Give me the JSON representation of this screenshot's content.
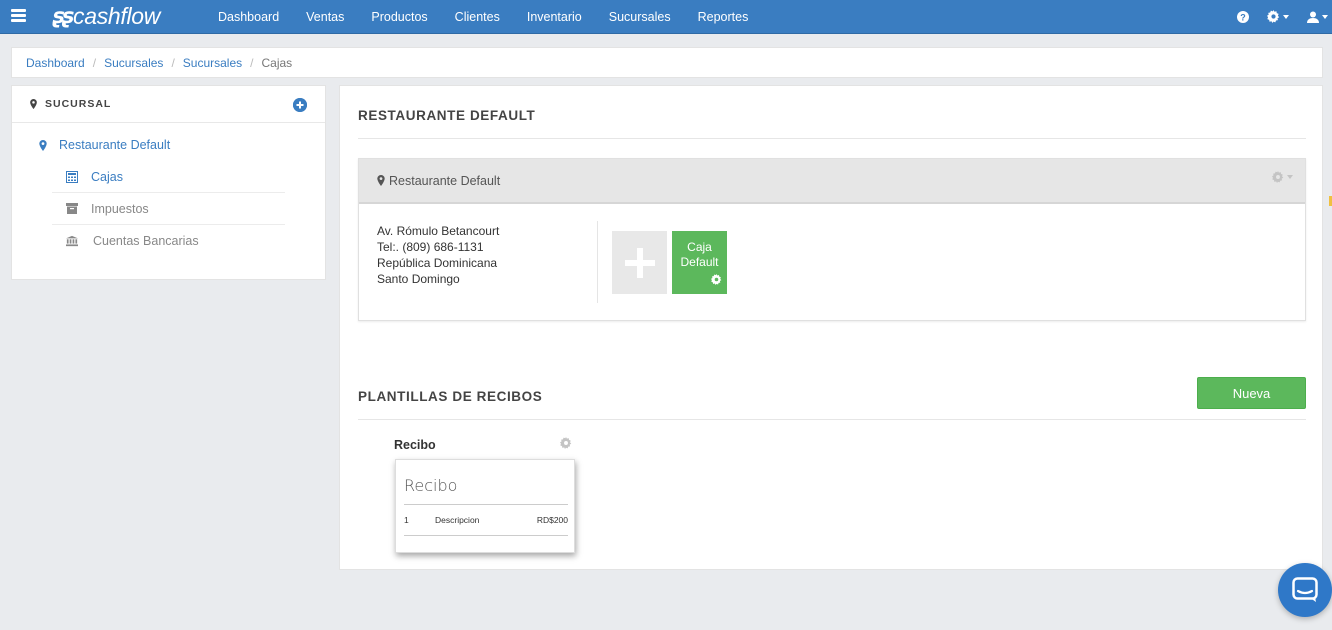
{
  "app": {
    "brand": "cashflow"
  },
  "nav": {
    "items": [
      "Dashboard",
      "Ventas",
      "Productos",
      "Clientes",
      "Inventario",
      "Sucursales",
      "Reportes"
    ]
  },
  "breadcrumb": {
    "items": [
      "Dashboard",
      "Sucursales",
      "Sucursales"
    ],
    "active": "Cajas"
  },
  "sidebar": {
    "header": "SUCURSAL",
    "branch": "Restaurante Default",
    "items": [
      {
        "label": "Cajas",
        "icon": "calculator-icon",
        "active": true
      },
      {
        "label": "Impuestos",
        "icon": "archive-icon",
        "active": false
      },
      {
        "label": "Cuentas Bancarias",
        "icon": "bank-icon",
        "active": false
      }
    ]
  },
  "main": {
    "title": "RESTAURANTE DEFAULT",
    "branch_card": {
      "name": "Restaurante Default",
      "address": [
        "Av. Rómulo Betancourt",
        "Tel:. (809) 686-1131",
        "República Dominicana",
        "Santo Domingo"
      ],
      "cajas": [
        {
          "line1": "Caja",
          "line2": "Default"
        }
      ]
    },
    "templates": {
      "title": "PLANTILLAS DE RECIBOS",
      "new_button": "Nueva",
      "items": [
        {
          "label": "Recibo",
          "preview": {
            "title": "Recibo",
            "row": {
              "qty": "1",
              "desc": "Descripcion",
              "amount": "RD$200"
            }
          }
        }
      ]
    }
  },
  "colors": {
    "topbar": "#3a7dc1",
    "accent": "#3a7dc1",
    "success": "#5cb85c",
    "background": "#e9ebee"
  }
}
